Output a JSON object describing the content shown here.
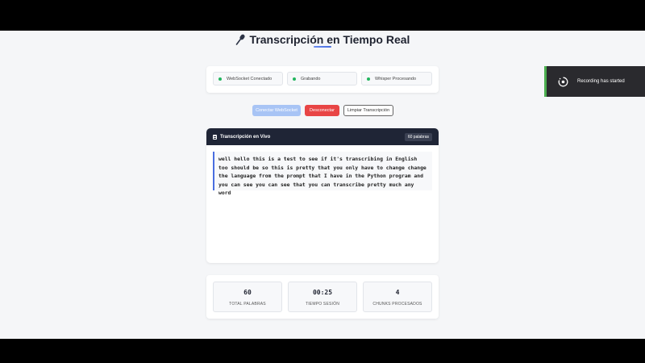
{
  "header": {
    "title": "Transcripción en Tiempo Real"
  },
  "status": [
    {
      "label": "WebSocket Conectado",
      "color": "#22b55e"
    },
    {
      "label": "Grabando",
      "color": "#22b55e"
    },
    {
      "label": "Whisper Procesando",
      "color": "#22b55e"
    }
  ],
  "buttons": {
    "connect": "Conectar WebSocket",
    "disconnect": "Desconectar",
    "clear": "Limpiar Transcripción"
  },
  "transcript": {
    "title": "Transcripción en Vivo",
    "word_badge": "60 palabras",
    "text": "well hello this is a test to see if it's transcribing in English too should be so this is pretty that you only have to change change the language from the prompt that I have in the Python program and you can see you can see that you can transcribe pretty much any word"
  },
  "stats": [
    {
      "value": "60",
      "label": "TOTAL PALABRAS"
    },
    {
      "value": "00:25",
      "label": "TIEMPO SESIÓN"
    },
    {
      "value": "4",
      "label": "CHUNKS PROCESADOS"
    }
  ],
  "toast": {
    "text": "Recording has started"
  },
  "colors": {
    "accent": "#4a6ee0",
    "danger": "#e84545",
    "success": "#22b55e",
    "header_dark": "#1f2536"
  }
}
